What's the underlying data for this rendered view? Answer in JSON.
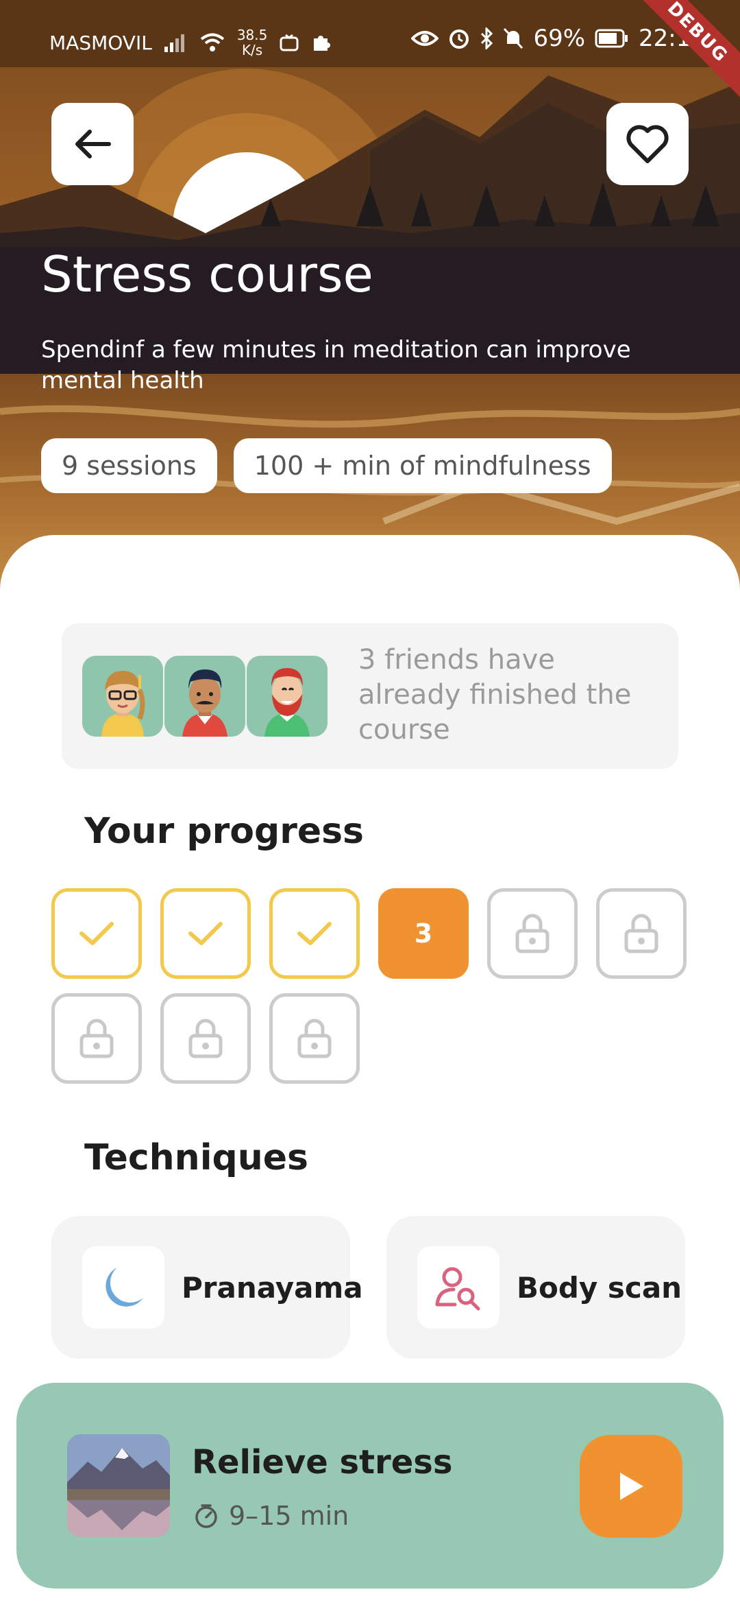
{
  "status_bar": {
    "carrier": "MASMOVIL",
    "net_speed_value": "38.5",
    "net_speed_unit": "K/s",
    "battery": "69%",
    "time": "22:18"
  },
  "debug_banner": "DEBUG",
  "course": {
    "title": "Stress course",
    "description": "Spendinf a few minutes in meditation can improve mental health",
    "chips": [
      "9 sessions",
      "100 + min of mindfulness"
    ]
  },
  "friends": {
    "text": "3 friends have already finished the course"
  },
  "progress": {
    "title": "Your progress",
    "completed": 3,
    "total": 9,
    "current_label": "3",
    "states": [
      "done",
      "done",
      "done",
      "current",
      "locked",
      "locked",
      "locked",
      "locked",
      "locked"
    ]
  },
  "techniques": {
    "title": "Techniques",
    "items": [
      {
        "label": "Pranayama",
        "icon": "moon-icon",
        "color": "#6aa8dc"
      },
      {
        "label": "Body scan",
        "icon": "user-search-icon",
        "color": "#d9627f"
      }
    ]
  },
  "player": {
    "title": "Relieve stress",
    "duration": "9–15 min",
    "accent": "#f0922f",
    "background": "#97c8b4"
  },
  "colors": {
    "done_border": "#f2c94c",
    "current_bg": "#f0922f",
    "locked_border": "#cccccc",
    "avatar_bg": "#8fc5ad"
  }
}
